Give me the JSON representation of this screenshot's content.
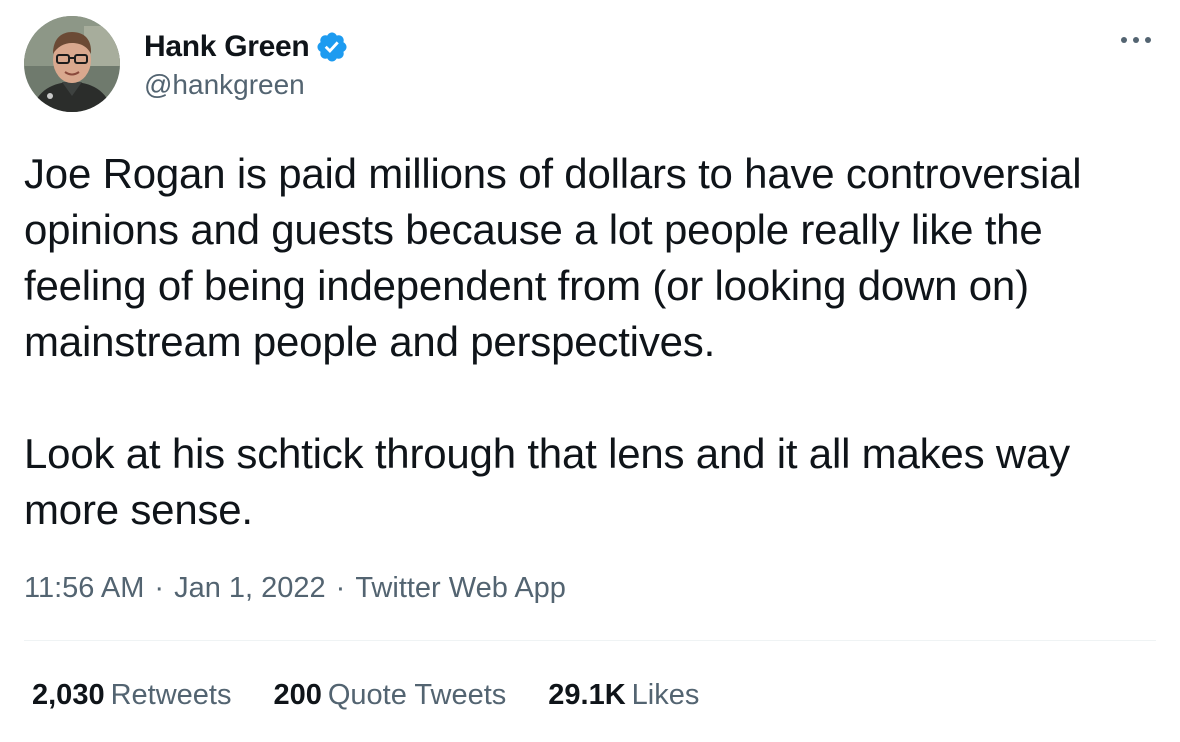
{
  "author": {
    "display_name": "Hank Green",
    "handle": "@hankgreen",
    "verified": true,
    "avatar_icon": "avatar-photo",
    "verified_icon": "verified-badge-icon"
  },
  "menu": {
    "more_icon": "more-options-icon"
  },
  "tweet": {
    "text": "Joe Rogan is paid millions of dollars to have controversial opinions and guests because a lot people really like the feeling of being independent from (or looking down on) mainstream people and perspectives.\n\nLook at his schtick through that lens and it all makes way more sense.",
    "time": "11:56 AM",
    "date": "Jan 1, 2022",
    "source": "Twitter Web App",
    "separator": "·"
  },
  "stats": {
    "retweets": {
      "count": "2,030",
      "label": "Retweets"
    },
    "quote_tweets": {
      "count": "200",
      "label": "Quote Tweets"
    },
    "likes": {
      "count": "29.1K",
      "label": "Likes"
    }
  },
  "colors": {
    "text_primary": "#0f1419",
    "text_secondary": "#536471",
    "verified_blue": "#1d9bf0",
    "divider": "#eff3f4"
  }
}
